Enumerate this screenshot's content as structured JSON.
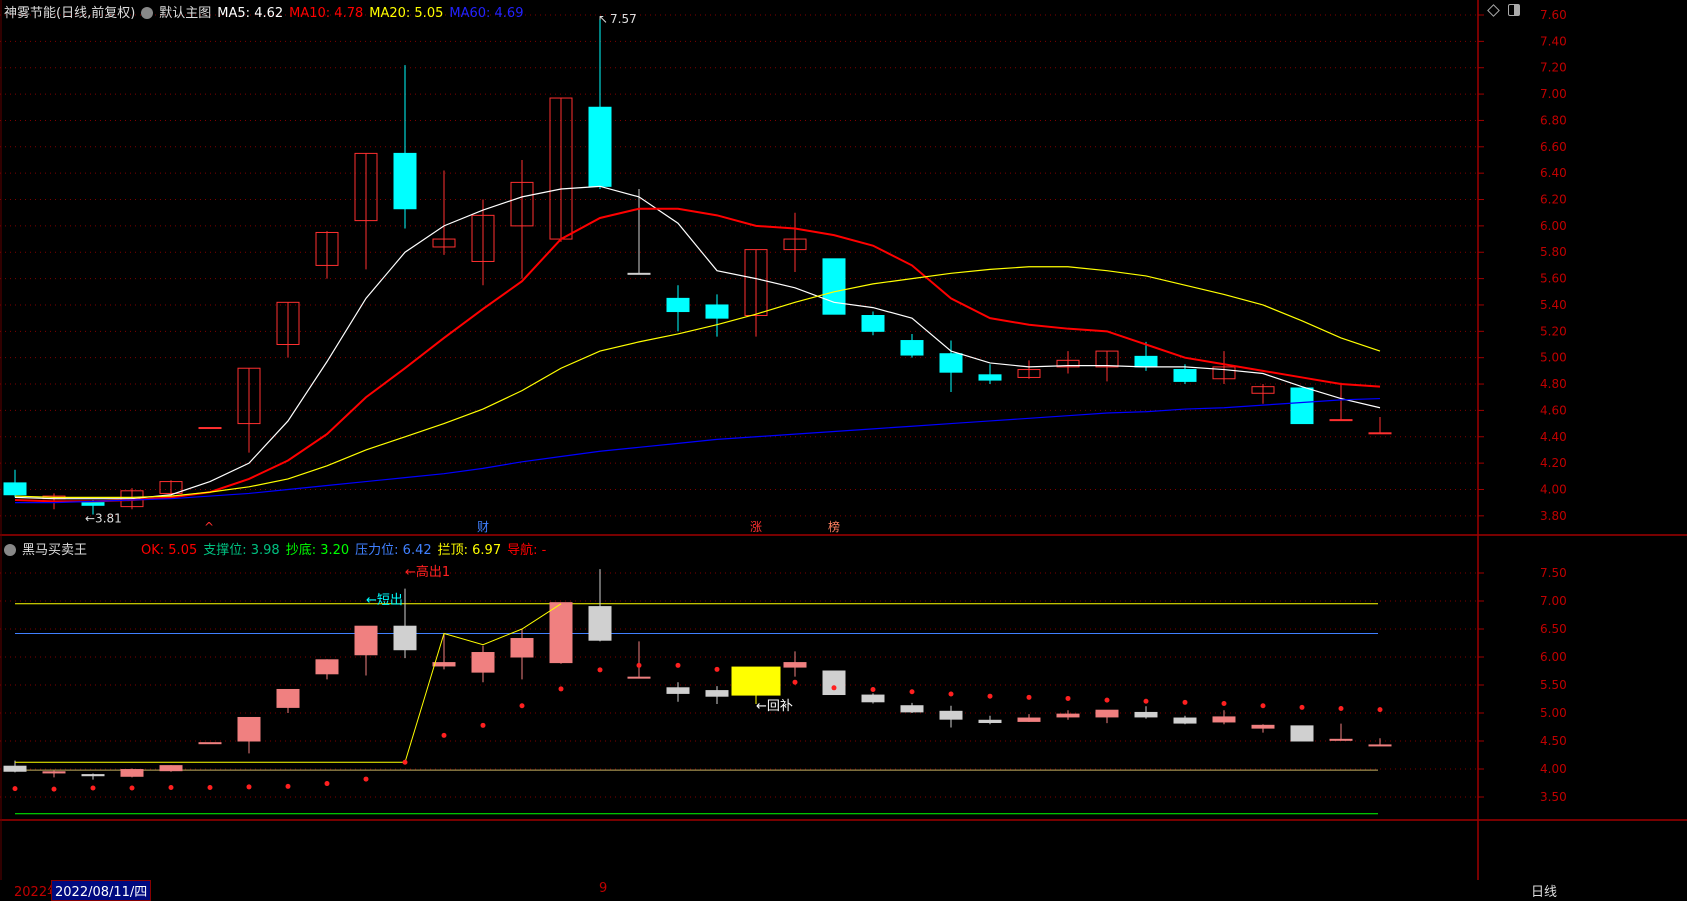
{
  "header": {
    "stock_title": "神雾节能(日线,前复权)",
    "template": "默认主图",
    "ma5": "MA5: 4.62",
    "ma10": "MA10: 4.78",
    "ma20": "MA20: 5.05",
    "ma60": "MA60: 4.69"
  },
  "indicator_header": {
    "name": "黑马买卖王",
    "ok": "OK: 5.05",
    "support": "支撑位: 3.98",
    "bottom": "抄底: 3.20",
    "pressure": "压力位: 6.42",
    "top": "拦顶: 6.97",
    "nav": "导航: -"
  },
  "bottom_bar": {
    "year": "2022年",
    "date": "2022/08/11/四",
    "month_mark": "9",
    "period": "日线"
  },
  "colors": {
    "up": "#ff3030",
    "down": "#00ffff",
    "ma5": "#ffffff",
    "ma10": "#ff0000",
    "ma20": "#ffff00",
    "ma60": "#0000ff",
    "axis": "#c00000"
  },
  "icons": {
    "top_right": [
      "diamond-icon",
      "panel-toggle-icon"
    ]
  },
  "chart_data": [
    {
      "type": "candlestick",
      "title": "神雾节能(日线,前复权)",
      "ylim": [
        3.7,
        7.65
      ],
      "yticks": [
        "7.60",
        "7.40",
        "7.20",
        "7.00",
        "6.80",
        "6.60",
        "6.40",
        "6.20",
        "6.00",
        "5.80",
        "5.60",
        "5.40",
        "5.20",
        "5.00",
        "4.80",
        "4.60",
        "4.40",
        "4.20",
        "4.00",
        "3.80"
      ],
      "grid": true,
      "ohlc": [
        [
          4.05,
          4.15,
          3.94,
          3.96
        ],
        [
          3.93,
          3.97,
          3.85,
          3.95
        ],
        [
          3.9,
          3.92,
          3.81,
          3.88
        ],
        [
          3.87,
          4.01,
          3.85,
          3.99
        ],
        [
          3.97,
          4.07,
          3.95,
          4.06
        ],
        [
          4.47,
          4.47,
          4.47,
          4.47
        ],
        [
          4.5,
          4.92,
          4.28,
          4.92
        ],
        [
          5.1,
          5.42,
          5.0,
          5.42
        ],
        [
          5.7,
          5.96,
          5.6,
          5.95
        ],
        [
          6.04,
          6.55,
          5.67,
          6.55
        ],
        [
          6.55,
          7.22,
          5.98,
          6.13
        ],
        [
          5.84,
          6.42,
          5.78,
          5.9
        ],
        [
          5.73,
          6.2,
          5.55,
          6.08
        ],
        [
          6.0,
          6.5,
          5.6,
          6.33
        ],
        [
          5.9,
          6.97,
          5.88,
          6.97
        ],
        [
          6.9,
          7.57,
          6.28,
          6.3
        ],
        [
          5.64,
          6.28,
          5.64,
          5.64
        ],
        [
          5.45,
          5.55,
          5.2,
          5.35
        ],
        [
          5.4,
          5.48,
          5.16,
          5.3
        ],
        [
          5.32,
          5.82,
          5.16,
          5.82
        ],
        [
          5.82,
          6.1,
          5.65,
          5.9
        ],
        [
          5.75,
          5.75,
          5.33,
          5.33
        ],
        [
          5.32,
          5.35,
          5.17,
          5.2
        ],
        [
          5.13,
          5.18,
          5.0,
          5.02
        ],
        [
          5.03,
          5.13,
          4.74,
          4.89
        ],
        [
          4.87,
          4.95,
          4.8,
          4.83
        ],
        [
          4.85,
          4.98,
          4.84,
          4.91
        ],
        [
          4.93,
          5.05,
          4.88,
          4.98
        ],
        [
          4.93,
          5.05,
          4.82,
          5.05
        ],
        [
          5.01,
          5.12,
          4.9,
          4.93
        ],
        [
          4.91,
          4.95,
          4.8,
          4.82
        ],
        [
          4.84,
          5.05,
          4.8,
          4.93
        ],
        [
          4.73,
          4.8,
          4.65,
          4.78
        ],
        [
          4.77,
          4.77,
          4.5,
          4.5
        ],
        [
          4.53,
          4.81,
          4.53,
          4.53
        ],
        [
          4.43,
          4.55,
          4.43,
          4.43
        ]
      ],
      "series": [
        {
          "name": "MA5",
          "values": [
            3.94,
            3.93,
            3.93,
            3.93,
            3.96,
            4.06,
            4.2,
            4.52,
            4.97,
            5.45,
            5.8,
            6.0,
            6.12,
            6.22,
            6.28,
            6.3,
            6.22,
            6.02,
            5.66,
            5.6,
            5.53,
            5.42,
            5.38,
            5.3,
            5.05,
            4.96,
            4.93,
            4.94,
            4.94,
            4.93,
            4.93,
            4.91,
            4.88,
            4.78,
            4.69,
            4.62
          ]
        },
        {
          "name": "MA10",
          "values": [
            3.92,
            3.91,
            3.91,
            3.92,
            3.94,
            3.98,
            4.08,
            4.22,
            4.42,
            4.7,
            4.92,
            5.15,
            5.37,
            5.58,
            5.9,
            6.06,
            6.13,
            6.13,
            6.08,
            6.0,
            5.98,
            5.93,
            5.85,
            5.7,
            5.45,
            5.3,
            5.25,
            5.22,
            5.2,
            5.1,
            5.0,
            4.95,
            4.9,
            4.85,
            4.8,
            4.78
          ]
        },
        {
          "name": "MA20",
          "values": [
            3.95,
            3.94,
            3.94,
            3.94,
            3.95,
            3.98,
            4.02,
            4.08,
            4.18,
            4.3,
            4.4,
            4.5,
            4.61,
            4.75,
            4.92,
            5.05,
            5.12,
            5.18,
            5.25,
            5.33,
            5.42,
            5.5,
            5.56,
            5.6,
            5.64,
            5.67,
            5.69,
            5.69,
            5.66,
            5.62,
            5.55,
            5.48,
            5.4,
            5.28,
            5.15,
            5.05
          ]
        },
        {
          "name": "MA60",
          "values": [
            3.9,
            3.9,
            3.91,
            3.92,
            3.93,
            3.95,
            3.97,
            4.0,
            4.03,
            4.06,
            4.09,
            4.12,
            4.16,
            4.21,
            4.25,
            4.29,
            4.32,
            4.35,
            4.38,
            4.4,
            4.42,
            4.44,
            4.46,
            4.48,
            4.5,
            4.52,
            4.54,
            4.56,
            4.58,
            4.59,
            4.61,
            4.62,
            4.64,
            4.66,
            4.68,
            4.69
          ]
        }
      ],
      "annotations": [
        {
          "text": "7.57",
          "index": 15,
          "price": 7.57
        },
        {
          "text": "←3.81",
          "index": 2,
          "price": 3.81
        }
      ],
      "event_marks": [
        {
          "text": "^",
          "index": 5,
          "color": "#ff3030"
        },
        {
          "text": "财",
          "index": 12,
          "color": "#4080ff"
        },
        {
          "text": "涨",
          "index": 19,
          "color": "#ff3030"
        },
        {
          "text": "榜",
          "index": 21,
          "color": "#ff8060"
        }
      ]
    },
    {
      "type": "candlestick",
      "title": "黑马买卖王",
      "ylim": [
        3.2,
        7.9
      ],
      "yticks": [
        "7.50",
        "7.00",
        "6.50",
        "6.00",
        "5.50",
        "5.00",
        "4.50",
        "4.00",
        "3.50"
      ],
      "grid": true,
      "highlight_index": 19,
      "levels": [
        {
          "name": "拦顶",
          "value": 6.95,
          "color": "#ffff00"
        },
        {
          "name": "压力位",
          "value": 6.42,
          "color": "#4080ff"
        },
        {
          "name": "支撑位",
          "value": 3.98,
          "color": "#c8b060"
        },
        {
          "name": "抄底",
          "value": 3.2,
          "color": "#00ff00"
        }
      ],
      "signal_line": [
        4.12,
        4.12,
        4.12,
        4.12,
        4.12,
        4.12,
        4.12,
        4.12,
        4.12,
        4.12,
        4.12,
        6.42,
        6.22,
        6.5,
        6.95
      ],
      "dots": [
        3.65,
        3.64,
        3.66,
        3.66,
        3.67,
        3.67,
        3.68,
        3.69,
        3.74,
        3.82,
        4.12,
        4.6,
        4.78,
        5.13,
        5.43,
        5.77,
        5.85,
        5.85,
        5.78,
        null,
        5.55,
        5.45,
        5.42,
        5.38,
        5.34,
        5.3,
        5.28,
        5.26,
        5.23,
        5.21,
        5.19,
        5.17,
        5.13,
        5.1,
        5.08,
        5.06
      ],
      "labels": [
        {
          "text": "←高出1",
          "index": 10,
          "price": 7.45,
          "color": "#ff2020"
        },
        {
          "text": "←短出",
          "index": 9,
          "price": 6.95,
          "color": "#00ffff"
        },
        {
          "text": "←回补",
          "index": 19,
          "price": 5.05,
          "color": "#ffffff"
        }
      ]
    }
  ]
}
